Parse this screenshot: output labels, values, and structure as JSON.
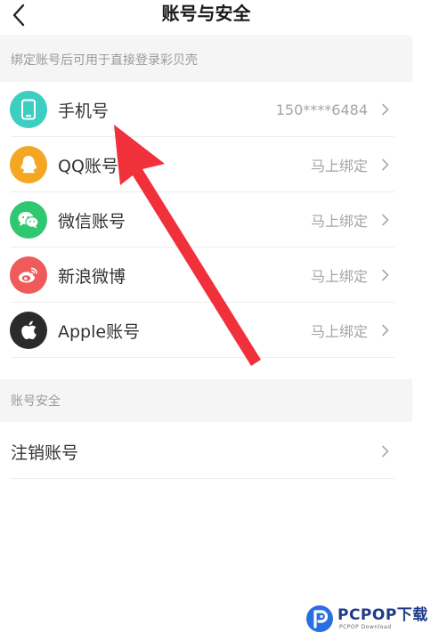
{
  "header": {
    "title": "账号与安全"
  },
  "sections": {
    "bind_hint": "绑定账号后可用于直接登录彩贝壳",
    "security": "账号安全"
  },
  "accounts": [
    {
      "label": "手机号",
      "value": "150****6484",
      "icon": "phone-icon",
      "color": "#3ccfc1"
    },
    {
      "label": "QQ账号",
      "value": "马上绑定",
      "icon": "qq-icon",
      "color": "#f5a623"
    },
    {
      "label": "微信账号",
      "value": "马上绑定",
      "icon": "wechat-icon",
      "color": "#2fc76f"
    },
    {
      "label": "新浪微博",
      "value": "马上绑定",
      "icon": "weibo-icon",
      "color": "#ef5b5b"
    },
    {
      "label": "Apple账号",
      "value": "马上绑定",
      "icon": "apple-icon",
      "color": "#2b2b2b"
    }
  ],
  "security_items": [
    {
      "label": "注销账号"
    }
  ],
  "watermark": {
    "main": "PCPOP下载",
    "sub": "PCPOP Download"
  }
}
